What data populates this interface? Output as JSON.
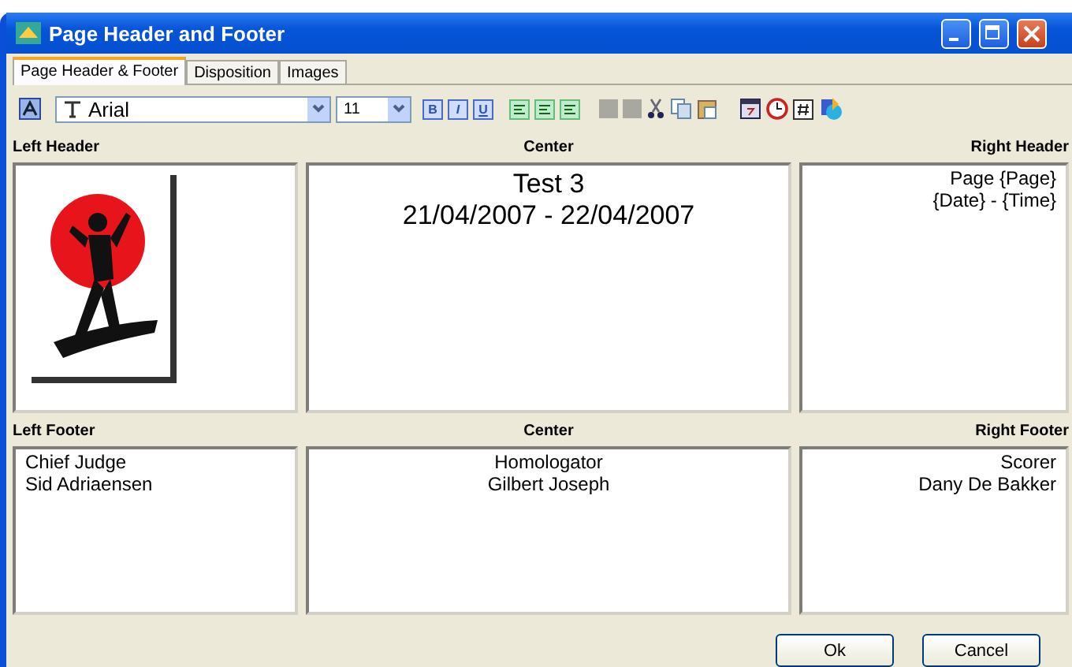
{
  "window": {
    "title": "Page Header and Footer"
  },
  "tabs": [
    {
      "label": "Page Header & Footer",
      "selected": true
    },
    {
      "label": "Disposition",
      "selected": false
    },
    {
      "label": "Images",
      "selected": false
    }
  ],
  "toolbar": {
    "font": "Arial",
    "size": "11",
    "format_buttons": [
      "B",
      "I",
      "U"
    ]
  },
  "header": [
    {
      "label": "Left Header",
      "kind": "picture"
    },
    {
      "label": "Center",
      "kind": "text",
      "lines": [
        "Test 3",
        "21/04/2007 - 22/04/2007"
      ]
    },
    {
      "label": "Right Header",
      "kind": "text",
      "lines": [
        "Page {Page}",
        "{Date} - {Time}"
      ]
    }
  ],
  "footer": [
    {
      "label": "Left Footer",
      "kind": "text",
      "lines": [
        "Chief Judge",
        "Sid Adriaensen"
      ]
    },
    {
      "label": "Center",
      "kind": "text",
      "lines": [
        "Homologator",
        "Gilbert Joseph"
      ]
    },
    {
      "label": "Right Footer",
      "kind": "text",
      "lines": [
        "Scorer",
        "Dany De Bakker"
      ]
    }
  ],
  "buttons": [
    "Ok",
    "Cancel"
  ]
}
